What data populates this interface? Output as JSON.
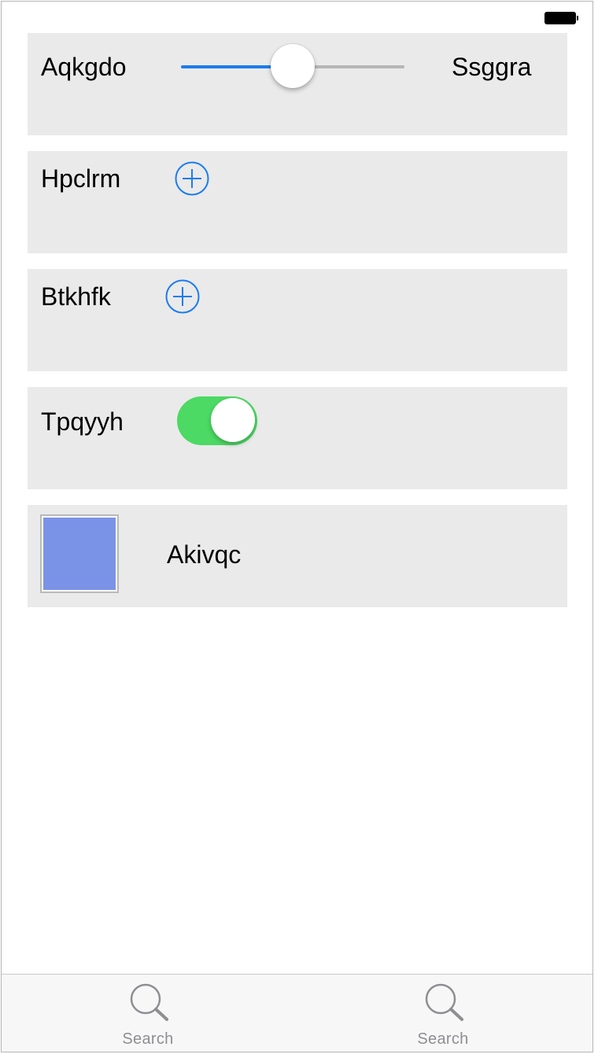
{
  "status_bar": {
    "battery_icon": "battery-icon"
  },
  "rows": [
    {
      "type": "slider",
      "label": "Aqkgdo",
      "trailing_label": "Ssggra",
      "slider_value": 0.5,
      "slider_color": "#1b7cf0"
    },
    {
      "type": "add-button",
      "label": "Hpclrm",
      "icon": "add-circle-icon"
    },
    {
      "type": "add-button",
      "label": "Btkhfk",
      "icon": "add-circle-icon"
    },
    {
      "type": "switch",
      "label": "Tpqyyh",
      "switch_on": true,
      "switch_color": "#4cd964"
    },
    {
      "type": "color-picker",
      "label": "Akivqc",
      "color": "#7b93e6"
    }
  ],
  "tabbar": {
    "tabs": [
      {
        "label": "Search",
        "icon": "search-icon"
      },
      {
        "label": "Search",
        "icon": "search-icon"
      }
    ]
  }
}
